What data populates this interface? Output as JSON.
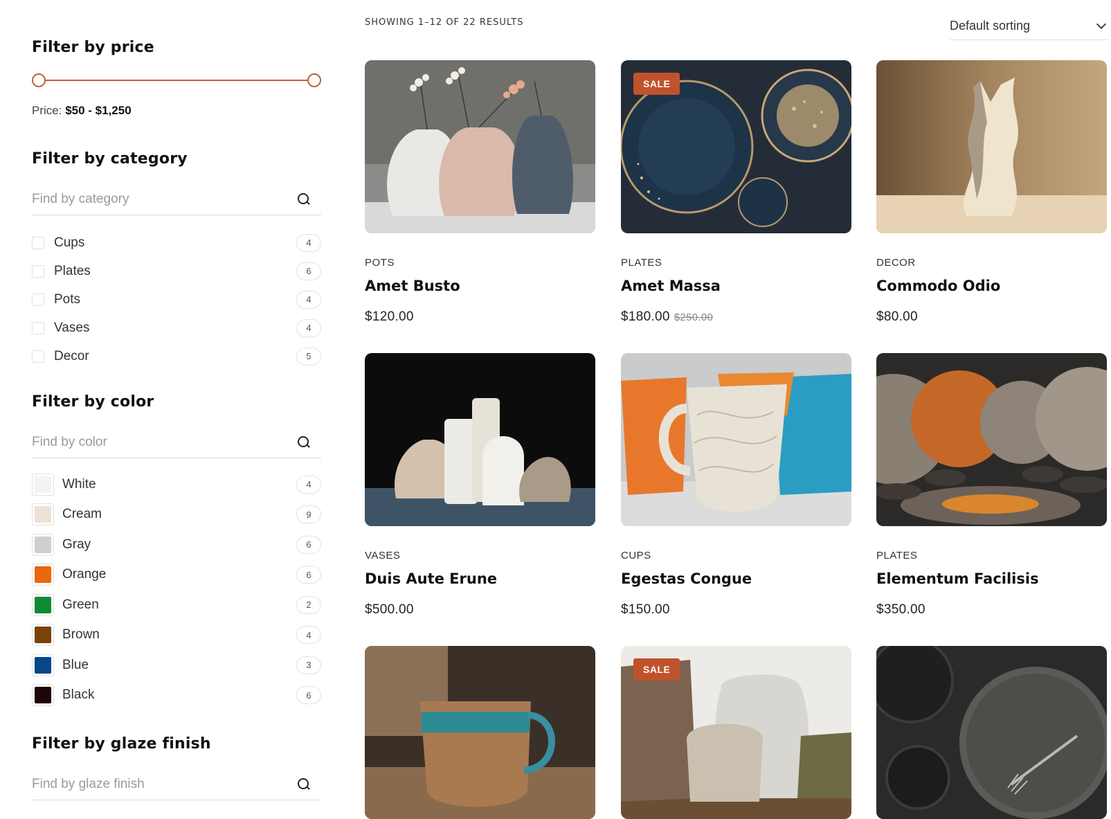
{
  "sidebar": {
    "price": {
      "title": "Filter by price",
      "label_prefix": "Price:",
      "range": "$50 - $1,250",
      "min": 50,
      "max": 1250,
      "accent_color": "#c2603a"
    },
    "category": {
      "title": "Filter by category",
      "search_placeholder": "Find by category",
      "items": [
        {
          "label": "Cups",
          "count": "4"
        },
        {
          "label": "Plates",
          "count": "6"
        },
        {
          "label": "Pots",
          "count": "4"
        },
        {
          "label": "Vases",
          "count": "4"
        },
        {
          "label": "Decor",
          "count": "5"
        }
      ]
    },
    "color": {
      "title": "Filter by color",
      "search_placeholder": "Find by color",
      "items": [
        {
          "label": "White",
          "count": "4",
          "swatch": "#f3f3f3"
        },
        {
          "label": "Cream",
          "count": "9",
          "swatch": "#eee1d4"
        },
        {
          "label": "Gray",
          "count": "6",
          "swatch": "#cfcfcf"
        },
        {
          "label": "Orange",
          "count": "6",
          "swatch": "#e8680f"
        },
        {
          "label": "Green",
          "count": "2",
          "swatch": "#0e8a34"
        },
        {
          "label": "Brown",
          "count": "4",
          "swatch": "#7a4208"
        },
        {
          "label": "Blue",
          "count": "3",
          "swatch": "#074789"
        },
        {
          "label": "Black",
          "count": "6",
          "swatch": "#1c0606"
        }
      ]
    },
    "glaze": {
      "title": "Filter by glaze finish",
      "search_placeholder": "Find by glaze finish"
    }
  },
  "main": {
    "result_count": "SHOWING 1–12 OF 22 RESULTS",
    "sort_value": "Default sorting",
    "sale_badge": "SALE",
    "products": [
      {
        "category": "POTS",
        "title": "Amet Busto",
        "price": "$120.00",
        "old_price": "",
        "sale": false,
        "image": "three-faceted-vases"
      },
      {
        "category": "PLATES",
        "title": "Amet Massa",
        "price": "$180.00",
        "old_price": "$250.00",
        "sale": true,
        "image": "dark-blue-plates"
      },
      {
        "category": "DECOR",
        "title": "Commodo Odio",
        "price": "$80.00",
        "old_price": "",
        "sale": false,
        "image": "abstract-sculpture"
      },
      {
        "category": "VASES",
        "title": "Duis Aute Erune",
        "price": "$500.00",
        "old_price": "",
        "sale": false,
        "image": "white-vases-collection"
      },
      {
        "category": "CUPS",
        "title": "Egestas Congue",
        "price": "$150.00",
        "old_price": "",
        "sale": false,
        "image": "colorful-mugs"
      },
      {
        "category": "PLATES",
        "title": "Elementum Facilisis",
        "price": "$350.00",
        "old_price": "",
        "sale": false,
        "image": "speckled-orange-plates"
      },
      {
        "category": "",
        "title": "",
        "price": "",
        "old_price": "",
        "sale": false,
        "image": "patterned-mug"
      },
      {
        "category": "",
        "title": "",
        "price": "",
        "old_price": "",
        "sale": true,
        "image": "rustic-jars"
      },
      {
        "category": "",
        "title": "",
        "price": "",
        "old_price": "",
        "sale": false,
        "image": "dark-plate-with-fork"
      }
    ]
  }
}
